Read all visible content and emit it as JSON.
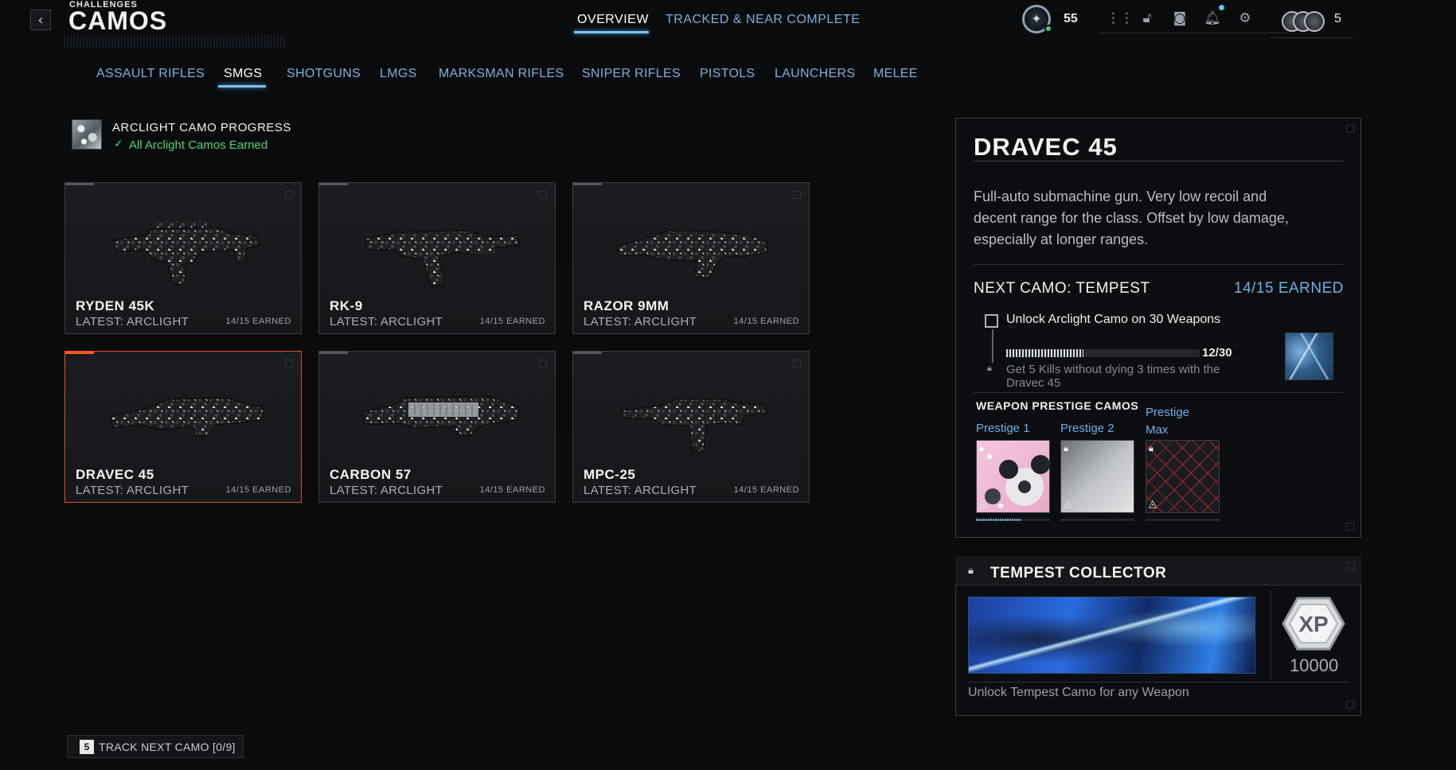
{
  "header": {
    "breadcrumb": "CHALLENGES",
    "title": "CAMOS",
    "back_icon": "chevron-left-icon",
    "tabs": [
      {
        "label": "OVERVIEW",
        "active": true
      },
      {
        "label": "TRACKED & NEAR COMPLETE",
        "active": false
      }
    ],
    "player_level": "55",
    "party_count": "5",
    "icons": [
      "grid-icon",
      "unlock-icon",
      "camera-icon",
      "bell-icon",
      "gear-icon"
    ],
    "accent_color": "#7cc1f0"
  },
  "categories": [
    {
      "label": "ASSAULT RIFLES",
      "active": false
    },
    {
      "label": "SMGS",
      "active": true
    },
    {
      "label": "SHOTGUNS",
      "active": false
    },
    {
      "label": "LMGS",
      "active": false
    },
    {
      "label": "MARKSMAN RIFLES",
      "active": false
    },
    {
      "label": "SNIPER RIFLES",
      "active": false
    },
    {
      "label": "PISTOLS",
      "active": false
    },
    {
      "label": "LAUNCHERS",
      "active": false
    },
    {
      "label": "MELEE",
      "active": false
    }
  ],
  "arclight": {
    "title": "ARCLIGHT CAMO PROGRESS",
    "status": "All Arclight Camos Earned",
    "status_color": "#4fd472"
  },
  "weapons": [
    {
      "name": "RYDEN 45K",
      "latest": "LATEST: ARCLIGHT",
      "earned": "14/15 EARNED",
      "selected": false
    },
    {
      "name": "RK-9",
      "latest": "LATEST: ARCLIGHT",
      "earned": "14/15 EARNED",
      "selected": false
    },
    {
      "name": "RAZOR 9MM",
      "latest": "LATEST: ARCLIGHT",
      "earned": "14/15 EARNED",
      "selected": false
    },
    {
      "name": "DRAVEC 45",
      "latest": "LATEST: ARCLIGHT",
      "earned": "14/15 EARNED",
      "selected": true
    },
    {
      "name": "CARBON 57",
      "latest": "LATEST: ARCLIGHT",
      "earned": "14/15 EARNED",
      "selected": false
    },
    {
      "name": "MPC-25",
      "latest": "LATEST: ARCLIGHT",
      "earned": "14/15 EARNED",
      "selected": false
    }
  ],
  "detail": {
    "title": "DRAVEC 45",
    "description": "Full-auto submachine gun. Very low recoil and decent range for the class. Offset by low damage, especially at longer ranges.",
    "next_camo": "NEXT CAMO: TEMPEST",
    "earned": "14/15 EARNED",
    "challenge": {
      "label": "Unlock Arclight Camo on 30 Weapons",
      "progress_text": "12/30",
      "progress_fraction": 0.4,
      "next_desc": "Get 5 Kills without dying 3 times with the Dravec 45"
    },
    "prestige": {
      "title": "WEAPON PRESTIGE CAMOS",
      "items": [
        {
          "label": "Prestige 1",
          "progress_fraction": 0.6
        },
        {
          "label": "Prestige 2",
          "progress_fraction": 0
        },
        {
          "label": "Prestige\nMax",
          "progress_fraction": 0
        }
      ]
    }
  },
  "collector": {
    "title": "TEMPEST COLLECTOR",
    "xp_label": "XP",
    "xp_value": "10000",
    "description": "Unlock Tempest Camo for any Weapon"
  },
  "footer": {
    "key": "5",
    "track_label": "TRACK NEXT CAMO [0/9]"
  }
}
